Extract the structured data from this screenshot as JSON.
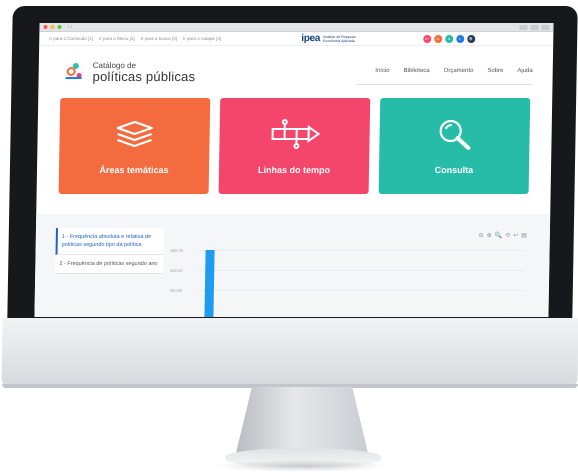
{
  "browser": {
    "nav": "‹  ›"
  },
  "accessibility_bar": {
    "links": [
      "Ir para o Conteúdo [1]",
      "Ir para o Menu [2]",
      "Ir para a busca [3]",
      "Ir para o rodapé [4]"
    ],
    "ipea_logo": "ipea",
    "ipea_subtitle": "Instituto de Pesquisa Econômica Aplicada",
    "toggles": [
      {
        "label": "A+",
        "color": "#f3466a"
      },
      {
        "label": "A-",
        "color": "#f56b40"
      },
      {
        "label": "A",
        "color": "#27bca8"
      },
      {
        "label": "",
        "color": "#1f7de0"
      },
      {
        "label": "",
        "color": "#333333"
      }
    ]
  },
  "header": {
    "logo_small": "Catálogo de",
    "logo_big": "políticas públicas",
    "menu": [
      "Início",
      "Biblioteca",
      "Orçamento",
      "Sobre",
      "Ajuda"
    ]
  },
  "cards": [
    {
      "label": "Áreas temáticas",
      "icon": "layers-icon",
      "color": "#f56b40"
    },
    {
      "label": "Linhas do tempo",
      "icon": "timeline-icon",
      "color": "#f3466a"
    },
    {
      "label": "Consulta",
      "icon": "search-icon",
      "color": "#27bca8"
    }
  ],
  "chart_panel": {
    "items": [
      "1 - Frequência absoluta e relativa de políticas segundo tipo da política",
      "2 - Frequência de políticas segundo ano"
    ],
    "tools": [
      "⊖",
      "⊕",
      "🔍",
      "⟲",
      "↩",
      "▤"
    ]
  },
  "chart_data": {
    "type": "bar",
    "y_ticks": [
      "600.00",
      "400.00",
      "200.00"
    ],
    "ylim": [
      0,
      600
    ],
    "values": [
      600
    ],
    "bar_color": "#1f9bf1"
  }
}
